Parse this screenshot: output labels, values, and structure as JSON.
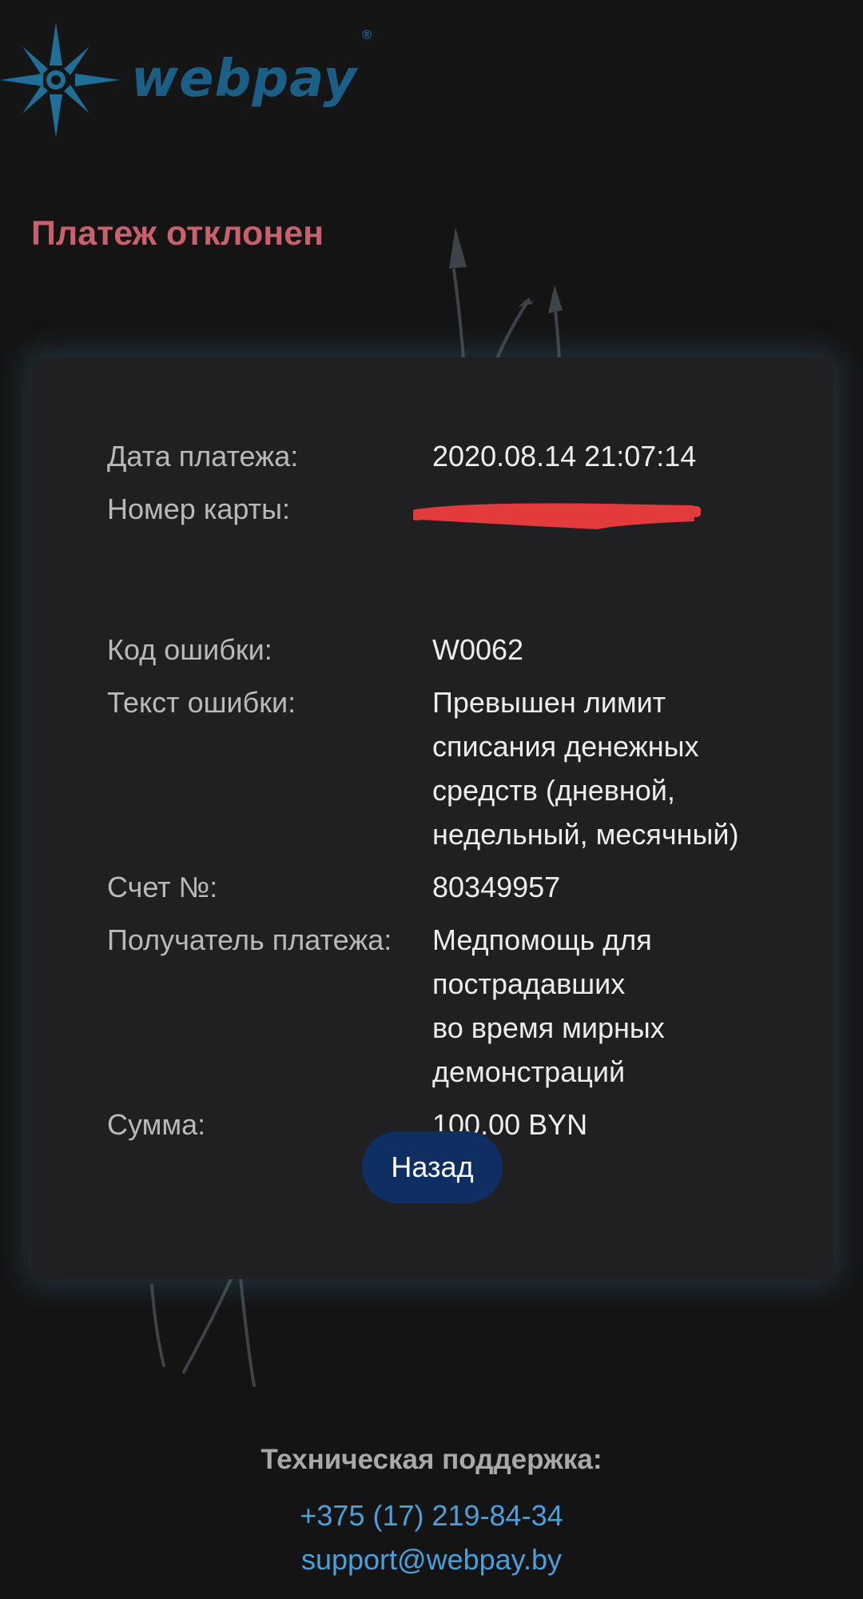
{
  "brand": {
    "name": "webpay",
    "registered_mark": "®",
    "logo_color": "#1c5f86"
  },
  "page": {
    "title": "Платеж отклонен",
    "title_color": "#c8616d"
  },
  "payment": {
    "date": {
      "label": "Дата платежа:",
      "value": "2020.08.14 21:07:14"
    },
    "card_number": {
      "label": "Номер карты:",
      "value": "",
      "redacted": true
    },
    "error_code": {
      "label": "Код ошибки:",
      "value": "W0062"
    },
    "error_text": {
      "label": "Текст ошибки:",
      "value": "Превышен лимит\nсписания денежных\nсредств (дневной,\nнедельный, месячный)"
    },
    "invoice": {
      "label": "Счет №:",
      "value": "80349957"
    },
    "recipient": {
      "label": "Получатель платежа:",
      "value": "Медпомощь для\nпострадавших\nво время мирных\nдемонстраций"
    },
    "amount": {
      "label": "Сумма:",
      "value": "100.00 BYN"
    }
  },
  "actions": {
    "back_label": "Назад",
    "back_color": "#0f2f62"
  },
  "support": {
    "title": "Техническая поддержка:",
    "phone": "+375 (17) 219-84-34",
    "email": "support@webpay.by",
    "link_color": "#4aa0dc"
  },
  "icons": {
    "logo": "compass-star-icon",
    "redaction": "red-scribble"
  }
}
